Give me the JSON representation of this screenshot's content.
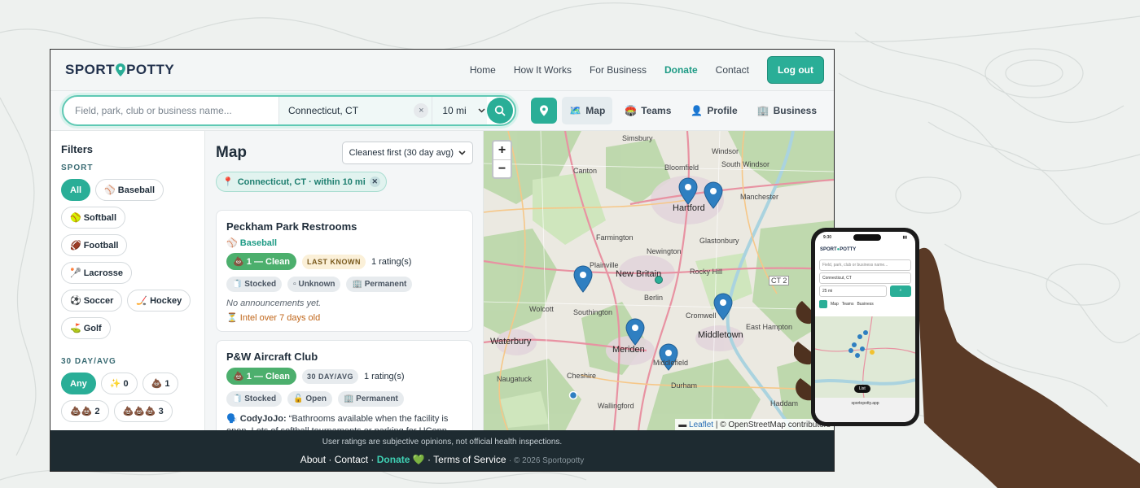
{
  "brand": {
    "logo_left": "SPORT",
    "logo_right": "POTTY"
  },
  "nav": {
    "items": [
      "Home",
      "How It Works",
      "For Business",
      "Donate",
      "Contact"
    ],
    "logout": "Log out"
  },
  "search": {
    "name_placeholder": "Field, park, club or business name...",
    "location": "Connecticut, CT",
    "clear": "×",
    "radius": "10 mi"
  },
  "tools": {
    "map": "Map",
    "teams": "Teams",
    "profile": "Profile",
    "business": "Business"
  },
  "filters": {
    "title": "Filters",
    "sport_label": "SPORT",
    "sports": [
      {
        "icon": "",
        "label": "All"
      },
      {
        "icon": "⚾",
        "label": "Baseball"
      },
      {
        "icon": "🥎",
        "label": "Softball"
      },
      {
        "icon": "🏈",
        "label": "Football"
      },
      {
        "icon": "🥍",
        "label": "Lacrosse"
      },
      {
        "icon": "⚽",
        "label": "Soccer"
      },
      {
        "icon": "🏒",
        "label": "Hockey"
      },
      {
        "icon": "⛳",
        "label": "Golf"
      }
    ],
    "avg_label": "30 DAY/AVG",
    "avg": [
      {
        "icon": "",
        "label": "Any"
      },
      {
        "icon": "✨",
        "label": "0"
      },
      {
        "icon": "💩",
        "label": "1"
      },
      {
        "icon": "💩💩",
        "label": "2"
      },
      {
        "icon": "💩💩💩",
        "label": "3"
      }
    ]
  },
  "list": {
    "title": "Map",
    "sort": "Cleanest first (30 day avg)",
    "location_tag": "Connecticut, CT · within 10 mi",
    "cards": [
      {
        "name": "Peckham Park Restrooms",
        "sport": "Baseball",
        "rating": "1 — Clean",
        "tag": "LAST KNOWN",
        "ratings_count": "1 rating(s)",
        "pills": [
          "Stocked",
          "Unknown",
          "Permanent"
        ],
        "note": "No announcements yet.",
        "intel": "Intel over 7 days old"
      },
      {
        "name": "P&W Aircraft Club",
        "rating": "1 — Clean",
        "tag": "30 DAY/AVG",
        "ratings_count": "1 rating(s)",
        "pills": [
          "Stocked",
          "Open",
          "Permanent"
        ],
        "quote_user": "CodyJoJo:",
        "quote": "“Bathrooms available when the facility is open. Lots of softball tournaments or parking for UConn football games.”"
      }
    ]
  },
  "map": {
    "zoom_in": "+",
    "zoom_out": "−",
    "labels": {
      "simsbury": "Simsbury",
      "windsor": "Windsor",
      "bloomfield": "Bloomfield",
      "south_windsor": "South Windsor",
      "canton": "Canton",
      "hartford": "Hartford",
      "manchester": "Manchester",
      "farmington": "Farmington",
      "glastonbury": "Glastonbury",
      "newington": "Newington",
      "new_britain": "New Britain",
      "plainville": "Plainville",
      "rocky_hill": "Rocky Hill",
      "wolcott": "Wolcott",
      "southington": "Southington",
      "berlin": "Berlin",
      "cromwell": "Cromwell",
      "meriden": "Meriden",
      "middletown": "Middletown",
      "east_hampton": "East Hampton",
      "waterbury": "Waterbury",
      "middlefield": "Middlefield",
      "cheshire": "Cheshire",
      "naugatuck": "Naugatuck",
      "wallingford": "Wallingford",
      "durham": "Durham",
      "haddam": "Haddam",
      "ct2": "CT 2"
    },
    "attribution_leaflet": "Leaflet",
    "attribution_rest": "| © OpenStreetMap contributors"
  },
  "footer": {
    "disclaimer": "User ratings are subjective opinions, not official health inspections.",
    "about": "About",
    "contact": "Contact",
    "donate": "Donate",
    "terms": "Terms of Service",
    "copyright": "· © 2026 Sportopotty"
  },
  "phone": {
    "time": "9:30",
    "search_placeholder": "Field, park, club or business name...",
    "location": "Connecticut, CT",
    "radius": "25 mi",
    "tools": [
      "Map",
      "Teams",
      "Business"
    ],
    "list_btn": "List",
    "url": "sportopotty.app"
  },
  "colors": {
    "accent": "#2aae97",
    "clean": "#4caf6d",
    "footer": "#1e2b31",
    "marker": "#2f7fc1"
  }
}
